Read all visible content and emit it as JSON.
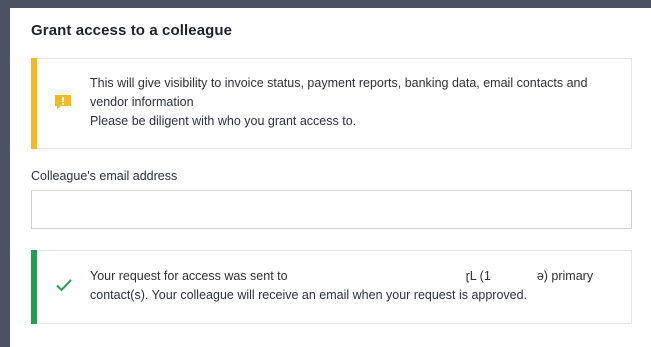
{
  "dialog": {
    "title": "Grant access to a colleague"
  },
  "warning": {
    "icon": "alert-exclamation-icon",
    "color": "#f5b921",
    "line1": "This will give visibility to invoice status, payment reports, banking data, email contacts and",
    "line2": "vendor information",
    "line3": "Please be diligent with who you grant access to."
  },
  "email": {
    "label": "Colleague's email address",
    "value": "",
    "placeholder": ""
  },
  "success": {
    "icon": "checkmark-icon",
    "color": "#20a152",
    "line1_a": "Your request for access was sent to",
    "line1_b": "ɽL (1",
    "line1_c": "ə) primary",
    "line2": "contact(s). Your colleague will receive an email when your request is approved."
  }
}
